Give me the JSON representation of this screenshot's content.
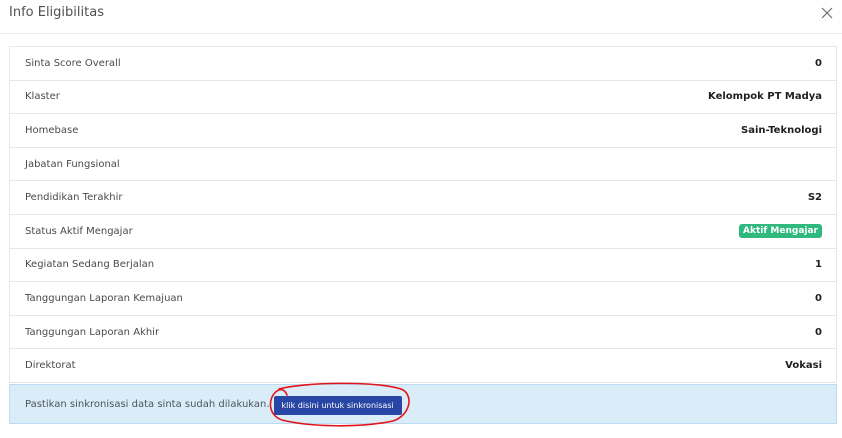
{
  "modal": {
    "title": "Info Eligibilitas",
    "close_icon": "close-icon"
  },
  "rows": [
    {
      "label": "Sinta Score Overall",
      "value": "0"
    },
    {
      "label": "Klaster",
      "value": "Kelompok PT Madya"
    },
    {
      "label": "Homebase",
      "value": "Sain-Teknologi"
    },
    {
      "label": "Jabatan Fungsional",
      "value": ""
    },
    {
      "label": "Pendidikan Terakhir",
      "value": "S2"
    },
    {
      "label": "Status Aktif Mengajar",
      "value": "Aktif Mengajar"
    },
    {
      "label": "Kegiatan Sedang Berjalan",
      "value": "1"
    },
    {
      "label": "Tanggungan Laporan Kemajuan",
      "value": "0"
    },
    {
      "label": "Tanggungan Laporan Akhir",
      "value": "0"
    },
    {
      "label": "Direktorat",
      "value": "Vokasi"
    }
  ],
  "alert": {
    "text": "Pastikan sinkronisasi data sinta sudah dilakukan.",
    "button_label": "klik disini untuk sinkronisasi"
  },
  "colors": {
    "badge_green": "#2fb97e",
    "button_blue": "#2846a4",
    "alert_bg": "#dbecf9",
    "annotation_red": "#e0151b"
  }
}
